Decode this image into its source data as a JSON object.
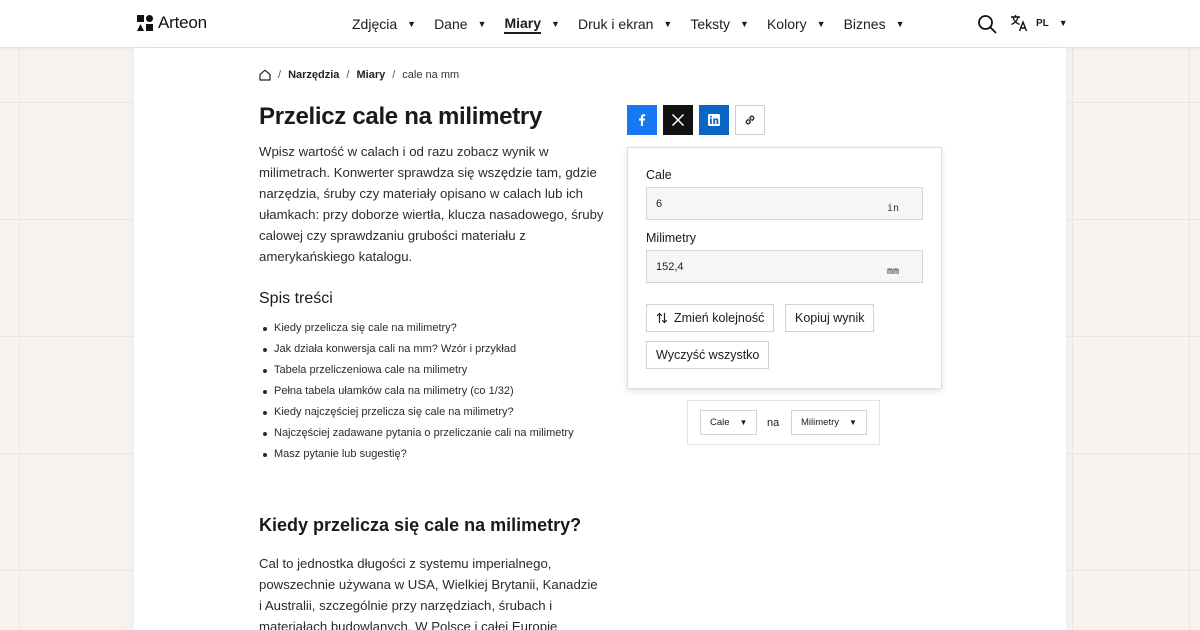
{
  "brand": {
    "name": "Arteon"
  },
  "nav": {
    "items": [
      {
        "label": "Zdjęcia"
      },
      {
        "label": "Dane"
      },
      {
        "label": "Miary",
        "active": true
      },
      {
        "label": "Druk i ekran"
      },
      {
        "label": "Teksty"
      },
      {
        "label": "Kolory"
      },
      {
        "label": "Biznes"
      }
    ],
    "search_icon": "search-icon",
    "language": {
      "code": "PL",
      "icon": "translate-icon"
    }
  },
  "breadcrumb": {
    "items": [
      "Narzędzia",
      "Miary"
    ],
    "current": "cale na mm",
    "separator": "/"
  },
  "main": {
    "title": "Przelicz cale na milimetry",
    "intro": "Wpisz wartość w calach i od razu zobacz wynik w milimetrach. Konwerter sprawdza się wszędzie tam, gdzie narzędzia, śruby czy materiały opisano w calach lub ich ułamkach: przy doborze wiertła, klucza nasadowego, śruby calowej czy sprawdzaniu grubości materiału z amerykańskiego katalogu.",
    "toc_title": "Spis treści",
    "toc": [
      "Kiedy przelicza się cale na milimetry?",
      "Jak działa konwersja cali na mm? Wzór i przykład",
      "Tabela przeliczeniowa cale na milimetry",
      "Pełna tabela ułamków cala na milimetry (co 1/32)",
      "Kiedy najczęściej przelicza się cale na milimetry?",
      "Najczęściej zadawane pytania o przeliczanie cali na milimetry",
      "Masz pytanie lub sugestię?"
    ],
    "section_title": "Kiedy przelicza się cale na milimetry?",
    "section_body": "Cal to jednostka długości z systemu imperialnego, powszechnie używana w USA, Wielkiej Brytanii, Kanadzie i Australii, szczególnie przy narzędziach, śrubach i materiałach budowlanych. W Polsce i całej Europie"
  },
  "share": {
    "facebook_icon": "facebook-icon",
    "x_icon": "x-icon",
    "linkedin_icon": "linkedin-icon",
    "link_icon": "link-icon"
  },
  "converter": {
    "inches": {
      "label": "Cale",
      "value": "6",
      "unit": "in"
    },
    "millimeters": {
      "label": "Milimetry",
      "value": "152,4",
      "unit": "mm"
    },
    "swap_label": "Zmień kolejność",
    "copy_label": "Kopiuj wynik",
    "clear_label": "Wyczyść wszystko"
  },
  "unit_switch": {
    "from": "Cale",
    "connector": "na",
    "to": "Milimetry"
  },
  "colors": {
    "facebook": "#1877f2",
    "x": "#111111",
    "linkedin": "#0a66c2",
    "background": "#f7f3ef"
  }
}
